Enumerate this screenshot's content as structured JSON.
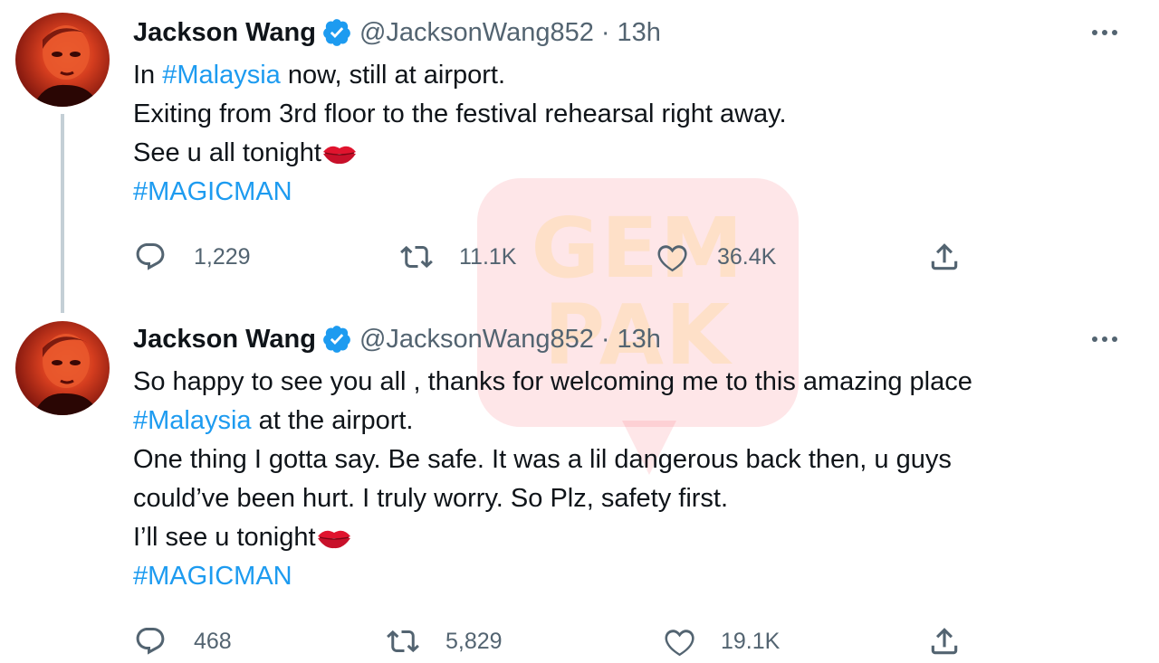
{
  "watermark": {
    "line1": "GEM",
    "line2": "PAK"
  },
  "accent_color": "#1d9bf0",
  "tweets": [
    {
      "author": {
        "name": "Jackson Wang",
        "handle": "@JacksonWang852",
        "separator": "·",
        "time": "13h",
        "verified_icon": "verified-badge-icon"
      },
      "body": {
        "l1_pre": "In ",
        "l1_tag": "#Malaysia",
        "l1_post": " now, still at airport.",
        "l2": "Exiting from 3rd floor to the festival rehearsal right away.",
        "l3": "See u all tonight",
        "l4_tag": "#MAGICMAN"
      },
      "stats": {
        "replies": "1,229",
        "retweets": "11.1K",
        "likes": "36.4K"
      }
    },
    {
      "author": {
        "name": "Jackson Wang",
        "handle": "@JacksonWang852",
        "separator": "·",
        "time": "13h",
        "verified_icon": "verified-badge-icon"
      },
      "body": {
        "l1": "So happy to see you all , thanks for welcoming me to this amazing place",
        "l2_tag": "#Malaysia",
        "l2_post": " at the airport.",
        "l3": "One thing I gotta say. Be safe. It was a lil dangerous back then, u guys",
        "l4": "could’ve been hurt. I truly worry. So Plz, safety first.",
        "l5": "I’ll see u tonight",
        "l6_tag": "#MAGICMAN"
      },
      "stats": {
        "replies": "468",
        "retweets": "5,829",
        "likes": "19.1K"
      }
    }
  ]
}
